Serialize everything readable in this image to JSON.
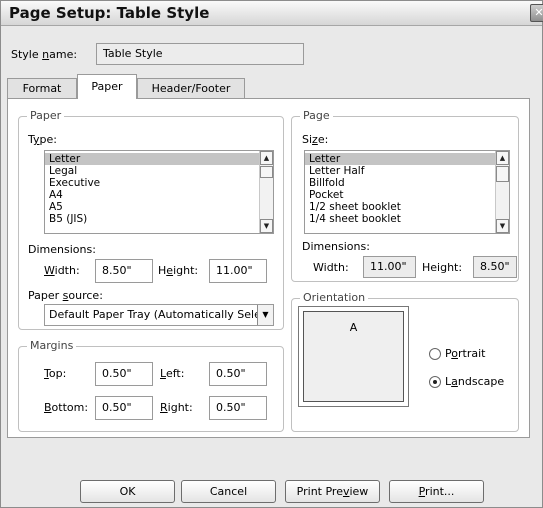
{
  "window": {
    "title": "Page Setup: Table Style",
    "close_glyph": "✕"
  },
  "style_name": {
    "label_pre": "Style ",
    "label_u": "n",
    "label_post": "ame:",
    "value": "Table Style"
  },
  "tabs": [
    {
      "label": "Format"
    },
    {
      "label": "Paper"
    },
    {
      "label": "Header/Footer"
    }
  ],
  "paper": {
    "legend": "Paper",
    "type_label_pre": "T",
    "type_label_u": "y",
    "type_label_post": "pe:",
    "types": [
      "Letter",
      "Legal",
      "Executive",
      "A4",
      "A5",
      "B5 (JIS)"
    ],
    "selected_index": 0,
    "dimensions_label": "Dimensions:",
    "width_label_u": "W",
    "width_label_post": "idth:",
    "width_value": "8.50\"",
    "height_label_pre": "H",
    "height_label_u": "e",
    "height_label_post": "ight:",
    "height_value": "11.00\"",
    "source_label_pre": "Paper ",
    "source_label_u": "s",
    "source_label_post": "ource:",
    "source_value": "Default Paper Tray (Automatically Sele"
  },
  "margins": {
    "legend": "Margins",
    "top_label_u": "T",
    "top_label_post": "op:",
    "top_value": "0.50\"",
    "left_label_u": "L",
    "left_label_post": "eft:",
    "left_value": "0.50\"",
    "bottom_label_u": "B",
    "bottom_label_post": "ottom:",
    "bottom_value": "0.50\"",
    "right_label_u": "R",
    "right_label_post": "ight:",
    "right_value": "0.50\""
  },
  "page": {
    "legend": "Page",
    "size_label_pre": "Si",
    "size_label_u": "z",
    "size_label_post": "e:",
    "sizes": [
      "Letter",
      "Letter Half",
      "Billfold",
      "Pocket",
      "1/2 sheet booklet",
      "1/4 sheet booklet"
    ],
    "selected_index": 0,
    "dimensions_label": "Dimensions:",
    "width_label": "Width:",
    "width_value": "11.00\"",
    "height_label": "Height:",
    "height_value": "8.50\""
  },
  "orientation": {
    "legend": "Orientation",
    "preview_letter": "A",
    "portrait_label_pre": "P",
    "portrait_label_u": "o",
    "portrait_label_post": "rtrait",
    "landscape_label_pre": "L",
    "landscape_label_u": "a",
    "landscape_label_post": "ndscape",
    "selected": "landscape"
  },
  "buttons": {
    "ok": "OK",
    "cancel": "Cancel",
    "print_preview_pre": "Print Pre",
    "print_preview_u": "v",
    "print_preview_post": "iew",
    "print_u": "P",
    "print_post": "rint..."
  },
  "icons": {
    "scroll_up": "▲",
    "scroll_down": "▼",
    "dropdown": "▼"
  }
}
